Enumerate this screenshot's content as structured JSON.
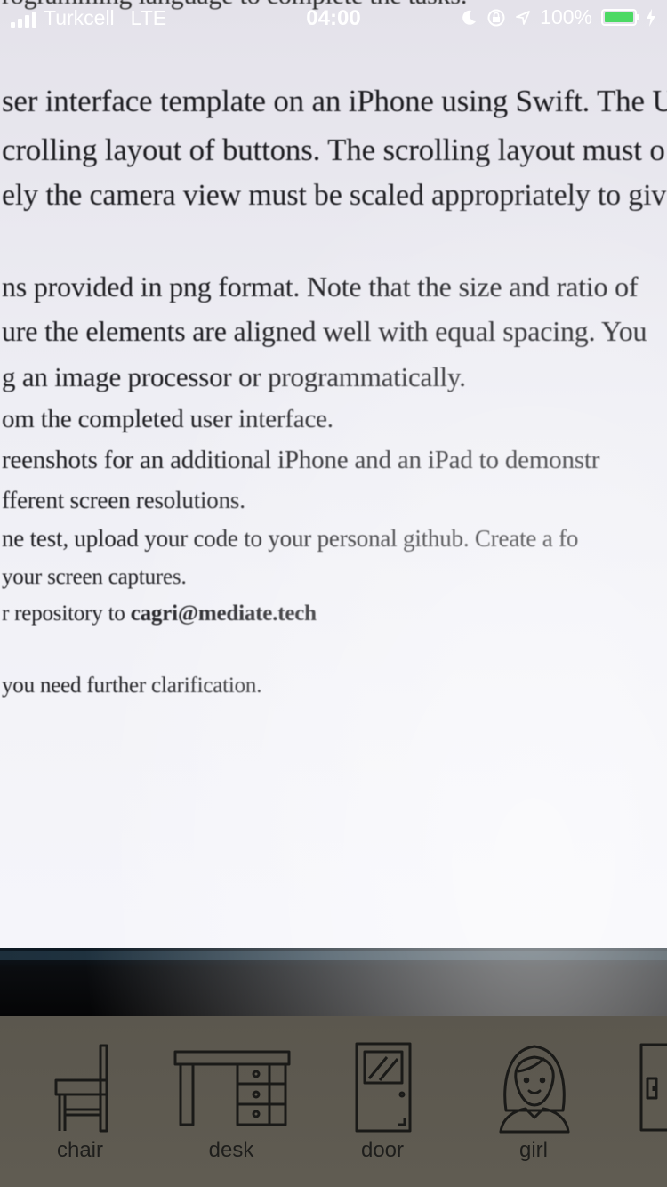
{
  "status_bar": {
    "carrier": "Turkcell",
    "network": "LTE",
    "time": "04:00",
    "battery_percent": "100%",
    "battery_level": 1.0,
    "icons": [
      "signal-icon",
      "moon-icon",
      "rotation-lock-icon",
      "location-icon",
      "battery-icon",
      "charging-icon"
    ]
  },
  "camera_text": {
    "line0": "rogramming language to complete the tasks.",
    "line1": "ser interface template on an iPhone using Swift. The U",
    "line2": "crolling layout of buttons. The scrolling layout must o",
    "line3": "ely the camera view must be scaled appropriately to giv",
    "line4": "ns provided in png format. Note that the size and ratio of",
    "line5": "ure the elements are aligned well with equal spacing. You",
    "line6": "g an image processor or programmatically.",
    "line7": "om the completed user interface.",
    "line8": "reenshots for an additional iPhone and an iPad to demonstr",
    "line9": "fferent screen resolutions.",
    "line10": "ne test, upload your code to your personal github. Create a fo",
    "line11": "your screen captures.",
    "line12_prefix": "r repository to ",
    "line12_email": "cagri@mediate.tech",
    "line13": "you need further clarification."
  },
  "tray": {
    "items": [
      {
        "label": "chair",
        "icon": "chair-icon"
      },
      {
        "label": "desk",
        "icon": "desk-icon"
      },
      {
        "label": "door",
        "icon": "door-icon"
      },
      {
        "label": "girl",
        "icon": "girl-icon"
      },
      {
        "label": "",
        "icon": "cabinet-icon"
      }
    ]
  },
  "colors": {
    "tray_background": "#5e5a50",
    "icon_stroke": "#1a1a18",
    "battery_fill": "#4cd964"
  }
}
